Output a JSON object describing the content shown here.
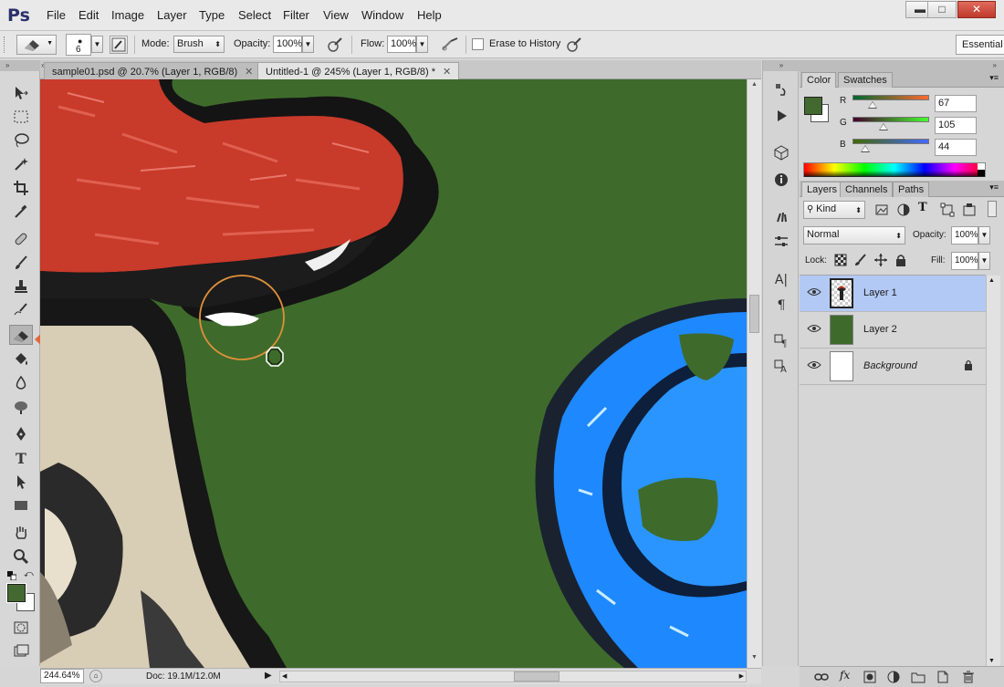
{
  "app": {
    "logo": "Ps"
  },
  "menu": [
    "File",
    "Edit",
    "Image",
    "Layer",
    "Type",
    "Select",
    "Filter",
    "View",
    "Window",
    "Help"
  ],
  "window_controls": {
    "minimize": "▬",
    "maximize": "□",
    "close": "✕"
  },
  "options": {
    "brush_size": "6",
    "mode_label": "Mode:",
    "mode_value": "Brush",
    "opacity_label": "Opacity:",
    "opacity_value": "100%",
    "flow_label": "Flow:",
    "flow_value": "100%",
    "erase_history_label": "Erase to History",
    "erase_history_checked": false,
    "workspace": "Essential"
  },
  "tabs": [
    {
      "label": "sample01.psd @ 20.7% (Layer 1, RGB/8)",
      "active": false
    },
    {
      "label": "Untitled-1 @ 245% (Layer 1, RGB/8) *",
      "active": true
    }
  ],
  "tools": [
    "move-icon",
    "marquee-icon",
    "lasso-icon",
    "quick-select-icon",
    "crop-icon",
    "eyedropper-icon",
    "healing-icon",
    "brush-icon",
    "clone-stamp-icon",
    "history-brush-icon",
    "eraser-icon",
    "paint-bucket-icon",
    "blur-icon",
    "dodge-icon",
    "pen-icon",
    "type-icon",
    "path-select-icon",
    "rectangle-icon",
    "hand-icon",
    "zoom-icon"
  ],
  "active_tool": "eraser-icon",
  "status": {
    "zoom": "244.64%",
    "doc": "Doc: 19.1M/12.0M"
  },
  "color_panel": {
    "tabs": [
      "Color",
      "Swatches"
    ],
    "r_label": "R",
    "r": "67",
    "g_label": "G",
    "g": "105",
    "b_label": "B",
    "b": "44",
    "foreground": "#436930",
    "background": "#ffffff"
  },
  "layers_panel": {
    "tabs": [
      "Layers",
      "Channels",
      "Paths"
    ],
    "filter_kind": "Kind",
    "blend_mode": "Normal",
    "opacity_label": "Opacity:",
    "opacity_value": "100%",
    "lock_label": "Lock:",
    "fill_label": "Fill:",
    "fill_value": "100%",
    "layers": [
      {
        "name": "Layer 1",
        "selected": true,
        "locked": false
      },
      {
        "name": "Layer 2",
        "selected": false,
        "locked": false
      },
      {
        "name": "Background",
        "selected": false,
        "locked": true
      }
    ]
  },
  "colors": {
    "canvas_green": "#3e6b2c",
    "mushroom_red": "#c83a2a",
    "ring_blue": "#1e88ff",
    "highlight_arrow": "#e0683f",
    "brush_circle": "#e0903a"
  }
}
